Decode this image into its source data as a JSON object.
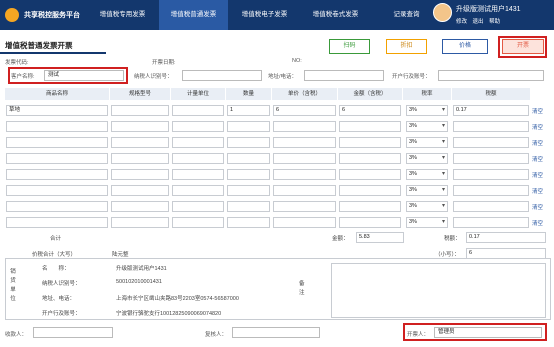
{
  "nav": {
    "brand": "共享税控服务平台",
    "tabs": [
      "增值税专用发票",
      "增值税普通发票",
      "增值税电子发票",
      "增值税卷式发票",
      "记录查询"
    ],
    "active_tab": 1,
    "user_name": "升级版测试用户1431",
    "links": [
      "修改",
      "退出",
      "帮助"
    ]
  },
  "page": {
    "title": "增值税普通发票开票",
    "buttons": {
      "scan": "扫码",
      "discount": "折扣",
      "price": "价格",
      "issue": "开票"
    }
  },
  "meta": {
    "invoice_code_label": "发票代码:",
    "issue_date_label": "开票日期:",
    "number_label": "NO:",
    "customer_label": "客户名称:",
    "customer_value": "测试",
    "taxpayer_id_label": "纳税人识别号：",
    "address_phone_label": "地址/电话：",
    "bank_account_label": "开户行及账号："
  },
  "table": {
    "headers": [
      "商品名称",
      "规格型号",
      "计量单位",
      "数量",
      "单价（含税）",
      "金额（含税）",
      "税率",
      "税额"
    ],
    "rows": [
      {
        "name": "草地",
        "spec": "",
        "unit": "",
        "qty": "1",
        "price": "6",
        "amount": "6",
        "rate": "3%",
        "tax": "0.17",
        "clear": "清空"
      },
      {
        "name": "",
        "spec": "",
        "unit": "",
        "qty": "",
        "price": "",
        "amount": "",
        "rate": "3%",
        "tax": "",
        "clear": "清空"
      },
      {
        "name": "",
        "spec": "",
        "unit": "",
        "qty": "",
        "price": "",
        "amount": "",
        "rate": "3%",
        "tax": "",
        "clear": "清空"
      },
      {
        "name": "",
        "spec": "",
        "unit": "",
        "qty": "",
        "price": "",
        "amount": "",
        "rate": "3%",
        "tax": "",
        "clear": "清空"
      },
      {
        "name": "",
        "spec": "",
        "unit": "",
        "qty": "",
        "price": "",
        "amount": "",
        "rate": "3%",
        "tax": "",
        "clear": "清空"
      },
      {
        "name": "",
        "spec": "",
        "unit": "",
        "qty": "",
        "price": "",
        "amount": "",
        "rate": "3%",
        "tax": "",
        "clear": "清空"
      },
      {
        "name": "",
        "spec": "",
        "unit": "",
        "qty": "",
        "price": "",
        "amount": "",
        "rate": "3%",
        "tax": "",
        "clear": "清空"
      },
      {
        "name": "",
        "spec": "",
        "unit": "",
        "qty": "",
        "price": "",
        "amount": "",
        "rate": "3%",
        "tax": "",
        "clear": "清空"
      }
    ]
  },
  "totals": {
    "sum_label": "合计",
    "amount_label": "金额：",
    "amount_value": "5.83",
    "tax_label": "税额：",
    "tax_value": "0.17",
    "in_words_label": "价税合计（大写）",
    "in_words_value": "陆元整",
    "small_label": "（小写）：",
    "small_value": "6"
  },
  "seller": {
    "side_label": "销 货 单 位",
    "name_label": "名　　称：",
    "name_value": "升级版测试用户1431",
    "tax_id_label": "纳税人识别号：",
    "tax_id_value": "500102010001431",
    "address_label": "地址、电话：",
    "address_value": "上海市长宁区凿山夹路83号2203室0574-56587000",
    "bank_label": "开户行及账号：",
    "bank_value": "宁波银行骆驼支行10012825090069074820",
    "remark_label": "备 注"
  },
  "footer": {
    "payee_label": "收款人：",
    "reviewer_label": "复核人：",
    "drawer_label": "开票人：",
    "drawer_value": "管理员"
  }
}
